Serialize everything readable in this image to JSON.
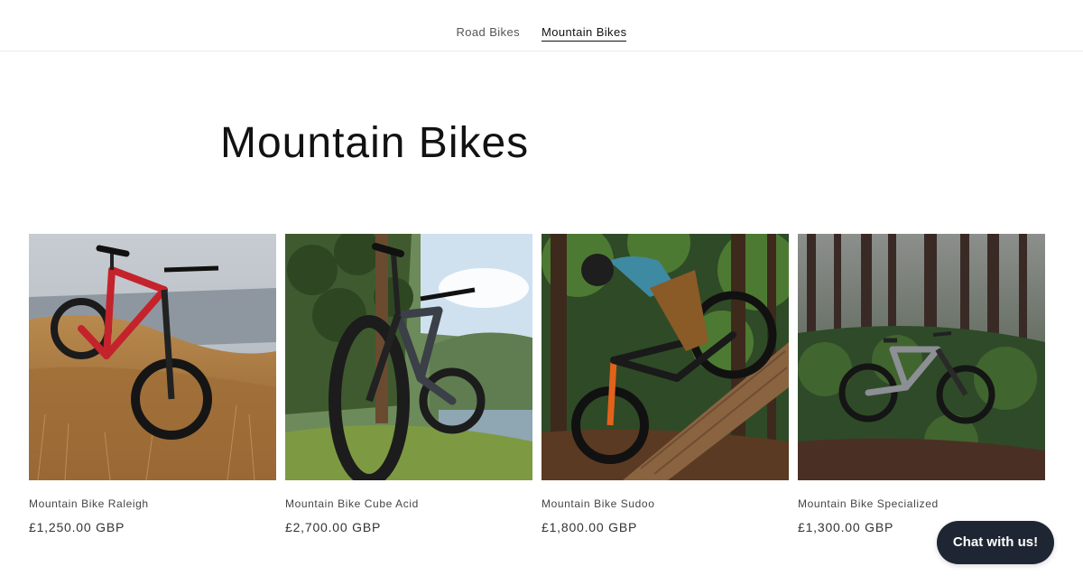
{
  "nav": {
    "items": [
      {
        "label": "Road Bikes",
        "active": false
      },
      {
        "label": "Mountain Bikes",
        "active": true
      }
    ]
  },
  "page": {
    "title": "Mountain Bikes"
  },
  "products": [
    {
      "name": "Mountain Bike Raleigh",
      "price": "£1,250.00 GBP",
      "image": "red-hardtail-bike-on-grass"
    },
    {
      "name": "Mountain Bike Cube Acid",
      "price": "£2,700.00 GBP",
      "image": "full-suspension-bike-by-lake"
    },
    {
      "name": "Mountain Bike Sudoo",
      "price": "£1,800.00 GBP",
      "image": "rider-on-ramp-in-forest"
    },
    {
      "name": "Mountain Bike Specialized",
      "price": "£1,300.00 GBP",
      "image": "bike-in-dark-forest"
    }
  ],
  "chat": {
    "label": "Chat with us!"
  },
  "colors": {
    "chat_bg": "#1f2633",
    "text": "#121212",
    "bike_red": "#c4232c"
  }
}
